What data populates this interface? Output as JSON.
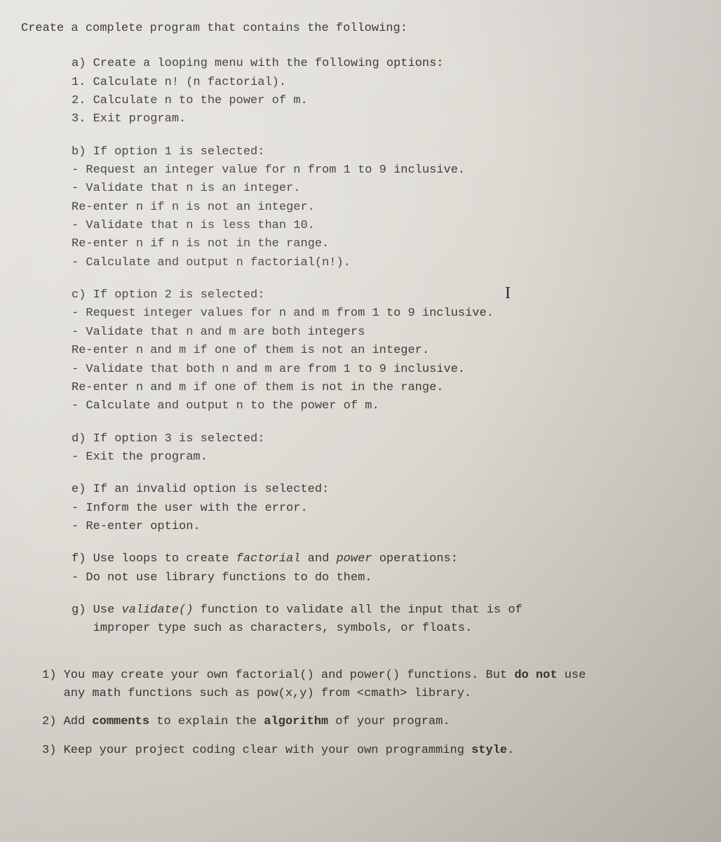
{
  "intro": "Create a complete program that contains the following:",
  "sections": {
    "a": {
      "head": "a) Create a looping menu with the following options:",
      "l1": "1. Calculate n! (n factorial).",
      "l2": "2. Calculate n to the power of m.",
      "l3": "3. Exit program."
    },
    "b": {
      "head": "b) If option 1 is selected:",
      "l1": "- Request an integer value for n from 1 to 9 inclusive.",
      "l2": "- Validate that n is an integer.",
      "l3": "Re-enter n if n is not an integer.",
      "l4": "- Validate that n is less than 10.",
      "l5": "Re-enter n if n is not in the range.",
      "l6": "- Calculate and output n factorial(n!)."
    },
    "c": {
      "head": "c) If option 2 is selected:",
      "l1": "- Request integer values for n and m from 1 to 9 inclusive.",
      "l2": "- Validate that n and m are both integers",
      "l3": "Re-enter n and m if one of them is not an integer.",
      "l4": "- Validate that both n and m are from 1 to 9 inclusive.",
      "l5": "Re-enter n and m if one of them is not in the range.",
      "l6": "- Calculate and output n to the power of m."
    },
    "d": {
      "head": "d) If option 3 is selected:",
      "l1": "- Exit the program."
    },
    "e": {
      "head": "e) If an invalid option is selected:",
      "l1": "- Inform the user with the error.",
      "l2": "- Re-enter option."
    },
    "f": {
      "pre": "f) Use loops to create ",
      "it1": "factorial",
      "mid": " and ",
      "it2": "power",
      "post": " operations:",
      "l1": "- Do not use library functions to do them."
    },
    "g": {
      "pre": "g) Use ",
      "it1": "validate()",
      "post": " function to validate all the input that is of",
      "l1": "   improper type such as characters, symbols, or floats."
    }
  },
  "numbered": {
    "n1": {
      "pre": "1) You may create your own factorial() and power() functions.  But ",
      "b": "do not",
      "post": " use",
      "l2": "   any math functions such as pow(x,y) from <cmath> library."
    },
    "n2": {
      "pre": "2) Add ",
      "b1": "comments",
      "mid": " to explain the ",
      "b2": "algorithm",
      "post": " of your program."
    },
    "n3": {
      "pre": "3) Keep your project coding clear with your own programming ",
      "b": "style",
      "post": "."
    }
  },
  "cursor": "I"
}
